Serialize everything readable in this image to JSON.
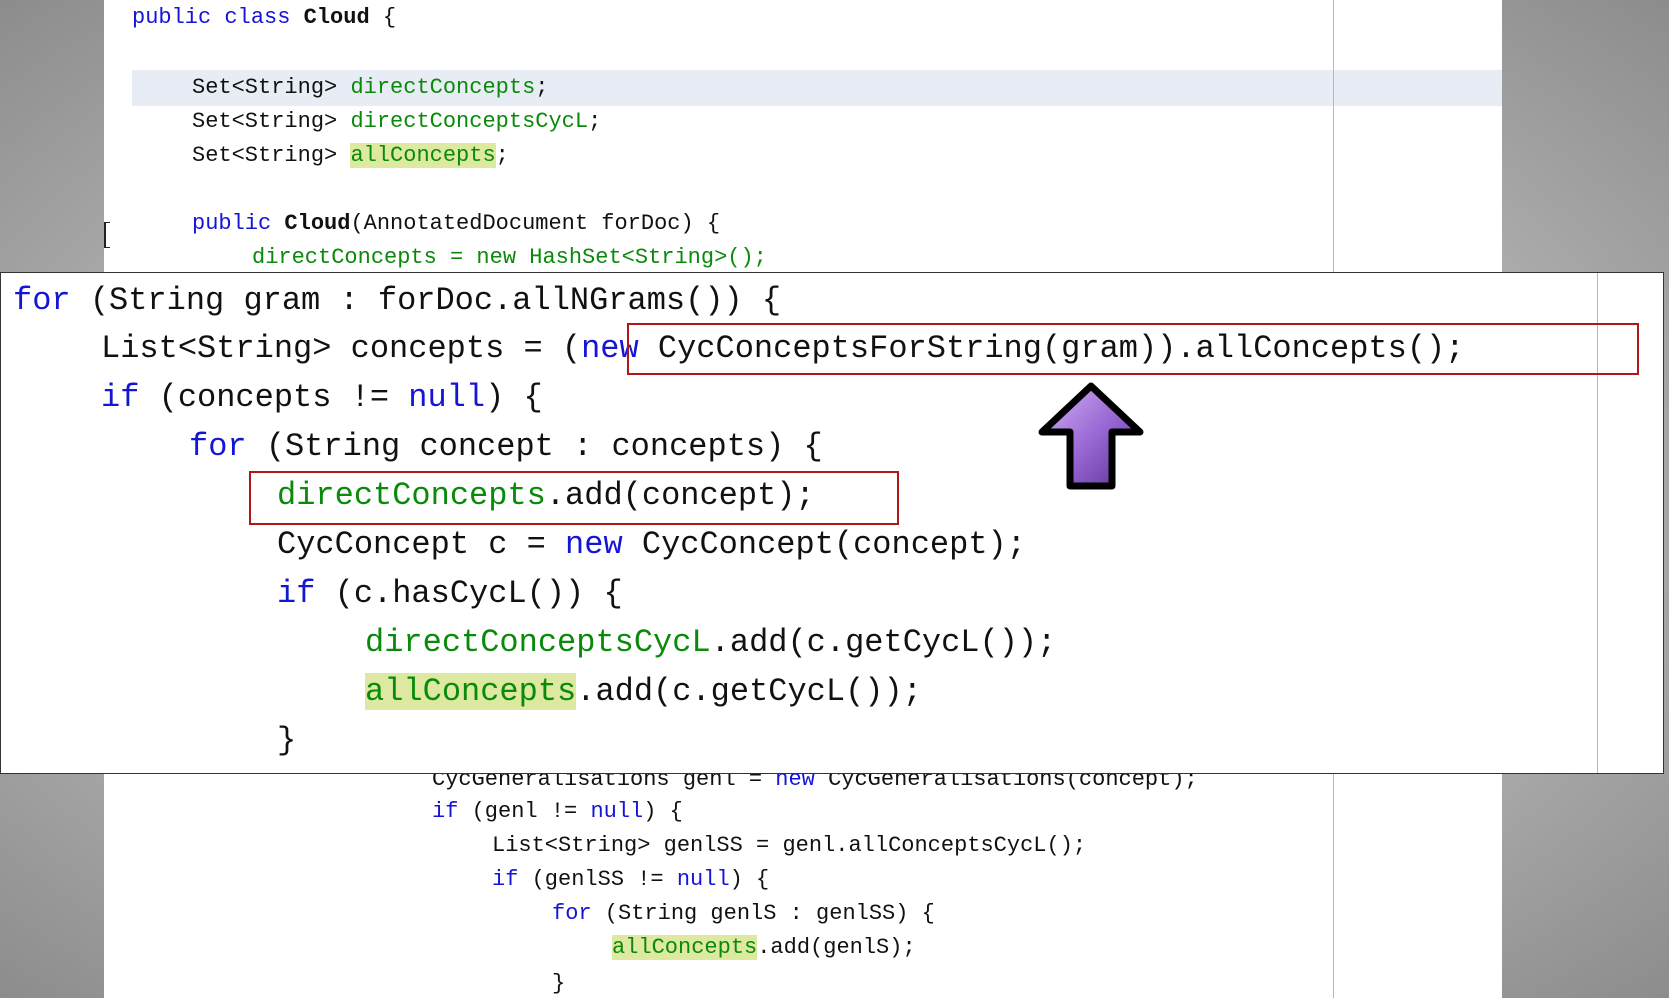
{
  "background_editor": {
    "class_decl": {
      "kw": "public class ",
      "name": "Cloud",
      "rest": " {"
    },
    "fields": [
      {
        "type": "Set<String> ",
        "name": "directConcepts",
        "end": ";"
      },
      {
        "type": "Set<String> ",
        "name": "directConceptsCycL",
        "end": ";"
      },
      {
        "type": "Set<String> ",
        "name": "allConcepts",
        "end": ";"
      }
    ],
    "ctor": {
      "kw": "public ",
      "name": "Cloud",
      "rest": "(AnnotatedDocument forDoc) {"
    },
    "partial_line": "directConcepts = new HashSet<String>();",
    "lower_lines": [
      {
        "a": "CycGeneralisations genl = ",
        "kw": "new",
        "b": " CycGeneralisations(concept);"
      },
      {
        "kw": "if",
        "b": " (genl != ",
        "kw2": "null",
        "c": ") {"
      },
      {
        "a": "List<String> genlSS = genl.allConceptsCycL();"
      },
      {
        "kw": "if",
        "b": " (genlSS != ",
        "kw2": "null",
        "c": ") {"
      },
      {
        "kw": "for",
        "b": " (String genlS : genlSS) {"
      },
      {
        "occ": "allConcepts",
        "c": ".add(genlS);"
      },
      {
        "a": "}"
      }
    ]
  },
  "zoom": {
    "lines": [
      {
        "kw": "for",
        "rest": " (String gram : forDoc.allNGrams()) {"
      },
      {
        "a": "List<String> concepts = ",
        "b": "(",
        "kw": "new",
        "c": " CycConceptsForString(gram)).allConcepts();"
      },
      {
        "kw": "if",
        "b": " (concepts != ",
        "kw2": "null",
        "c": ") {"
      },
      {
        "kw": "for",
        "rest": " (String concept : concepts) {"
      },
      {
        "fld": "directConcepts",
        "rest": ".add(concept);"
      },
      {
        "a": "CycConcept c = ",
        "kw": "new",
        "rest": " CycConcept(concept);"
      },
      {
        "kw": "if",
        "rest": " (c.hasCycL()) {"
      },
      {
        "fld": "directConceptsCycL",
        "rest": ".add(c.getCycL());"
      },
      {
        "occ": "allConcepts",
        "rest": ".add(c.getCycL());"
      },
      {
        "a": "}"
      }
    ]
  },
  "colors": {
    "keyword": "#1515d6",
    "field": "#0a8a0a",
    "occurrence": "#dde8a0",
    "highlight_box": "#b01818",
    "arrow": "#9a6ad6"
  },
  "icons": {
    "pointer": "up-arrow-icon"
  }
}
